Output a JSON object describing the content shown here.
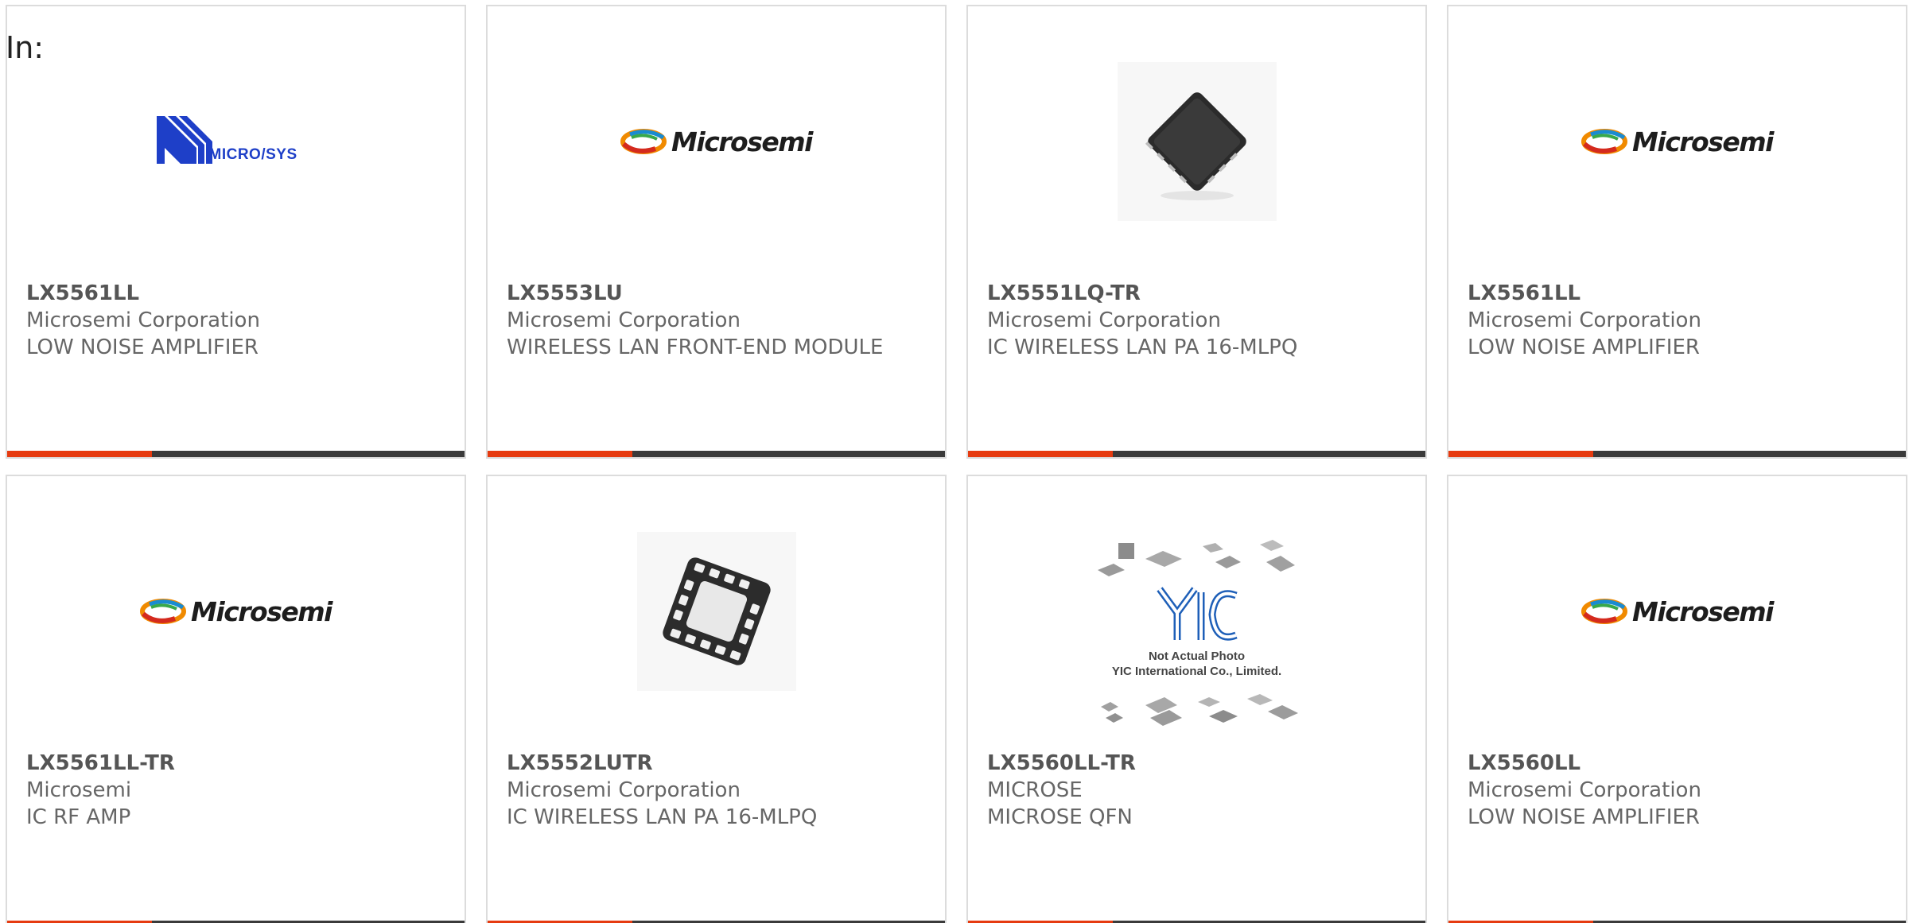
{
  "header": {
    "in_label": "In:"
  },
  "products": [
    {
      "part_number": "LX5561LL",
      "manufacturer": "Microsemi Corporation",
      "description": "LOW NOISE AMPLIFIER",
      "image": "micro-sys-logo",
      "logo_text": "MICRO/SYS"
    },
    {
      "part_number": "LX5553LU",
      "manufacturer": "Microsemi Corporation",
      "description": "WIRELESS LAN FRONT-END MODULE",
      "image": "microsemi-logo",
      "logo_text": "Microsemi"
    },
    {
      "part_number": "LX5551LQ-TR",
      "manufacturer": "Microsemi Corporation",
      "description": "IC WIRELESS LAN PA 16-MLPQ",
      "image": "qfn-chip-photo"
    },
    {
      "part_number": "LX5561LL",
      "manufacturer": "Microsemi Corporation",
      "description": "LOW NOISE AMPLIFIER",
      "image": "microsemi-logo",
      "logo_text": "Microsemi"
    },
    {
      "part_number": "LX5561LL-TR",
      "manufacturer": "Microsemi",
      "description": "IC RF AMP",
      "image": "microsemi-logo",
      "logo_text": "Microsemi"
    },
    {
      "part_number": "LX5552LUTR",
      "manufacturer": "Microsemi Corporation",
      "description": "IC WIRELESS LAN PA 16-MLPQ",
      "image": "mlpq-chip-photo"
    },
    {
      "part_number": "LX5560LL-TR",
      "manufacturer": "MICROSE",
      "description": "MICROSE QFN",
      "image": "yic-placeholder",
      "placeholder_line1": "Not Actual Photo",
      "placeholder_line2": "YIC International Co., Limited."
    },
    {
      "part_number": "LX5560LL",
      "manufacturer": "Microsemi Corporation",
      "description": "LOW NOISE AMPLIFIER",
      "image": "microsemi-logo",
      "logo_text": "Microsemi"
    }
  ],
  "colors": {
    "accent": "#e63b10",
    "bar": "#3a3a3a",
    "border": "#dcdcdc",
    "text": "#666666"
  }
}
